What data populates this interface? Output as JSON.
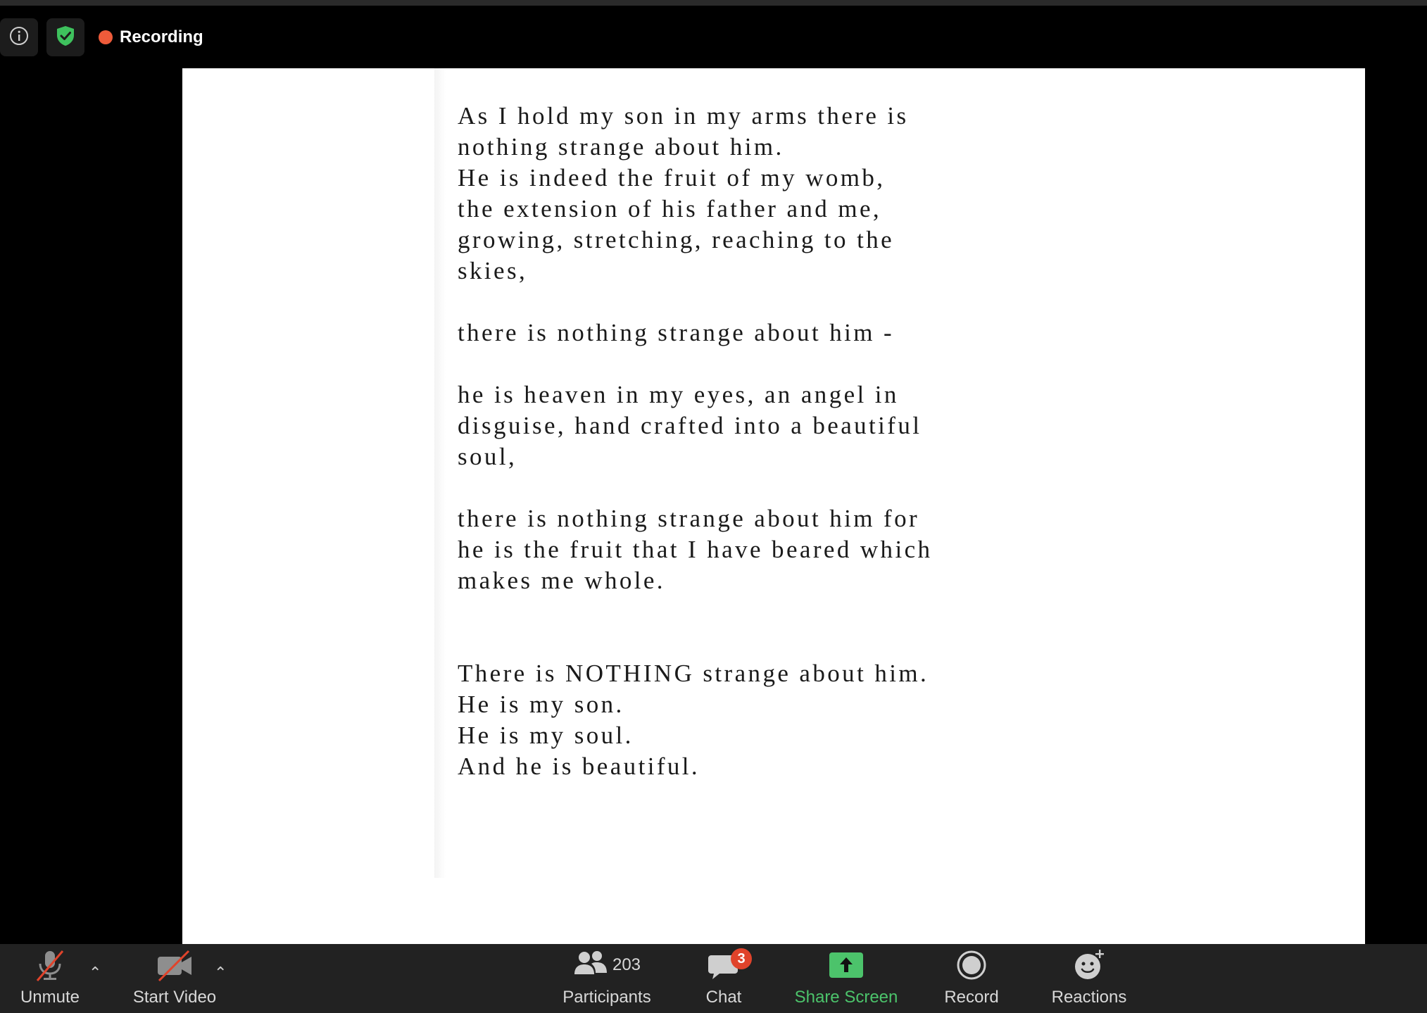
{
  "header": {
    "recording_label": "Recording"
  },
  "poem": {
    "lines": [
      "As I hold my son in my arms there is",
      "nothing strange about him.",
      "He is indeed the fruit of my womb,",
      "the extension of his father and me,",
      "growing, stretching, reaching to the",
      "skies,",
      "there is nothing strange about him -",
      "he is heaven in my eyes, an angel in",
      "disguise, hand crafted into a beautiful",
      "soul,",
      "there is nothing strange about him for",
      "he is the fruit that I have beared which",
      "makes me whole.",
      "There is NOTHING strange about him.",
      "He is my son.",
      "He is my soul.",
      "And he is beautiful."
    ]
  },
  "toolbar": {
    "unmute_label": "Unmute",
    "start_video_label": "Start Video",
    "participants_label": "Participants",
    "participants_count": "203",
    "chat_label": "Chat",
    "chat_badge": "3",
    "share_screen_label": "Share Screen",
    "record_label": "Record",
    "reactions_label": "Reactions"
  },
  "colors": {
    "accent_green": "#4cc36b",
    "recording_red": "#ee5b3a",
    "badge_red": "#e0432b",
    "toolbar_bg": "#222222"
  }
}
